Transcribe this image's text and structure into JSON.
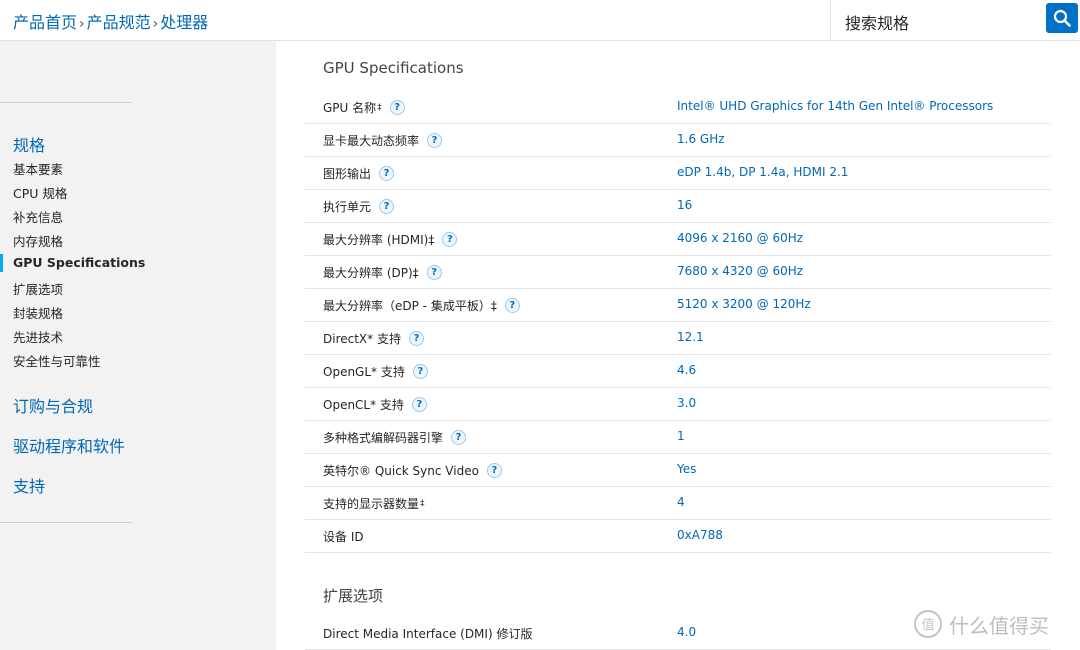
{
  "header": {
    "breadcrumb": [
      "产品首页",
      "产品规范",
      "处理器"
    ],
    "separator": "›",
    "search_placeholder": "搜索规格"
  },
  "sidebar": {
    "section_specs": "规格",
    "items": [
      "基本要素",
      "CPU 规格",
      "补充信息",
      "内存规格",
      "GPU Specifications",
      "扩展选项",
      "封装规格",
      "先进技术",
      "安全性与可靠性"
    ],
    "active_index": 4,
    "section_order": "订购与合规",
    "section_drivers": "驱动程序和软件",
    "section_support": "支持"
  },
  "main": {
    "gpu_title": "GPU Specifications",
    "rows": [
      {
        "label": "GPU 名称",
        "dagger": "‡",
        "help": true,
        "value": "Intel® UHD Graphics for 14th Gen Intel® Processors"
      },
      {
        "label": "显卡最大动态频率",
        "dagger": "",
        "help": true,
        "value": "1.6 GHz"
      },
      {
        "label": "图形输出",
        "dagger": "",
        "help": true,
        "value": "eDP 1.4b, DP 1.4a, HDMI 2.1"
      },
      {
        "label": "执行单元",
        "dagger": "",
        "help": true,
        "value": "16"
      },
      {
        "label": "最大分辨率 (HDMI)‡",
        "dagger": "",
        "help": true,
        "value": "4096 x 2160 @ 60Hz"
      },
      {
        "label": "最大分辨率 (DP)‡",
        "dagger": "",
        "help": true,
        "value": "7680 x 4320 @ 60Hz"
      },
      {
        "label": "最大分辨率（eDP - 集成平板）‡",
        "dagger": "",
        "help": true,
        "value": "5120 x 3200 @ 120Hz"
      },
      {
        "label": "DirectX* 支持",
        "dagger": "",
        "help": true,
        "value": "12.1"
      },
      {
        "label": "OpenGL* 支持",
        "dagger": "",
        "help": true,
        "value": "4.6"
      },
      {
        "label": "OpenCL* 支持",
        "dagger": "",
        "help": true,
        "value": "3.0"
      },
      {
        "label": "多种格式编解码器引擎",
        "dagger": "",
        "help": true,
        "value": "1"
      },
      {
        "label": "英特尔® Quick Sync Video",
        "dagger": "",
        "help": true,
        "value": "Yes"
      },
      {
        "label": "支持的显示器数量",
        "dagger": "‡",
        "help": false,
        "value": "4"
      },
      {
        "label": "设备 ID",
        "dagger": "",
        "help": false,
        "value": "0xA788"
      }
    ],
    "expansion_title": "扩展选项",
    "expansion_rows": [
      {
        "label": "Direct Media Interface (DMI) 修订版",
        "value": "4.0"
      }
    ]
  },
  "help_glyph": "?",
  "watermark": {
    "text": "什么值得买",
    "logo_glyph": "值"
  },
  "colors": {
    "link": "#0068b5",
    "accent": "#0071c5",
    "active_bar": "#00aeef"
  }
}
